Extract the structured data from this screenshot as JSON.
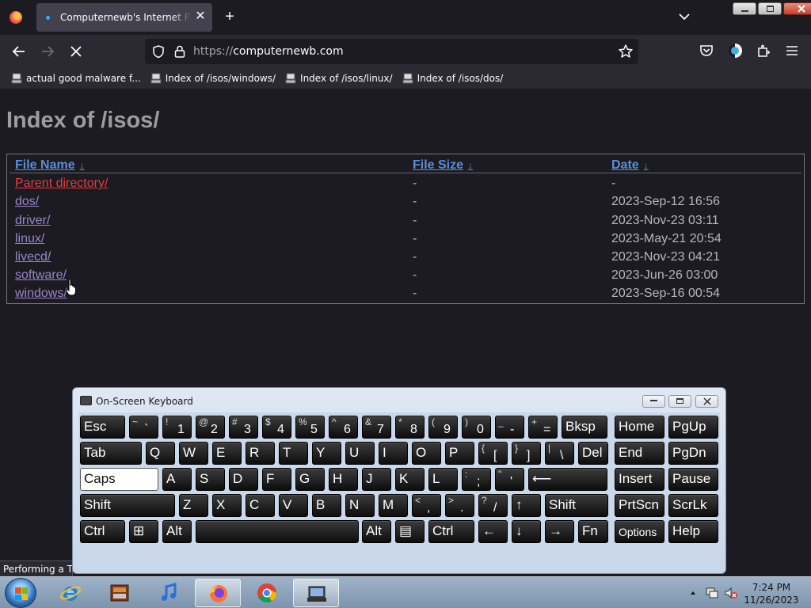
{
  "browser": {
    "tab_title": "Computernewb's Internet Pub",
    "tab_close": "✕",
    "new_tab": "+",
    "url_scheme": "https://",
    "url_host": "computernewb.com",
    "bookmarks": [
      {
        "label": "actual good malware f..."
      },
      {
        "label": "Index of /isos/windows/"
      },
      {
        "label": "Index of /isos/linux/"
      },
      {
        "label": "Index of /isos/dos/"
      }
    ]
  },
  "page": {
    "title": "Index of /isos/",
    "headers": {
      "name": "File Name",
      "size": "File Size",
      "date": "Date",
      "sort_indicator": "↓"
    },
    "rows": [
      {
        "name": "Parent directory/",
        "size": "-",
        "date": "-"
      },
      {
        "name": "dos/",
        "size": "-",
        "date": "2023-Sep-12 16:56"
      },
      {
        "name": "driver/",
        "size": "-",
        "date": "2023-Nov-23 03:11"
      },
      {
        "name": "linux/",
        "size": "-",
        "date": "2023-May-21 20:54"
      },
      {
        "name": "livecd/",
        "size": "-",
        "date": "2023-Nov-23 04:21"
      },
      {
        "name": "software/",
        "size": "-",
        "date": "2023-Jun-26 03:00"
      },
      {
        "name": "windows/",
        "size": "-",
        "date": "2023-Sep-16 00:54"
      }
    ]
  },
  "status_text": "Performing a TL",
  "osk": {
    "title": "On-Screen Keyboard",
    "rows": [
      [
        {
          "t": "lbl",
          "l": "Esc"
        },
        {
          "t": "dual",
          "s": "~",
          "c": "`"
        },
        {
          "t": "dual",
          "s": "!",
          "c": "1"
        },
        {
          "t": "dual",
          "s": "@",
          "c": "2"
        },
        {
          "t": "dual",
          "s": "#",
          "c": "3"
        },
        {
          "t": "dual",
          "s": "$",
          "c": "4"
        },
        {
          "t": "dual",
          "s": "%",
          "c": "5"
        },
        {
          "t": "dual",
          "s": "^",
          "c": "6"
        },
        {
          "t": "dual",
          "s": "&",
          "c": "7"
        },
        {
          "t": "dual",
          "s": "*",
          "c": "8"
        },
        {
          "t": "dual",
          "s": "(",
          "c": "9"
        },
        {
          "t": "dual",
          "s": ")",
          "c": "0"
        },
        {
          "t": "dual",
          "s": "_",
          "c": "-"
        },
        {
          "t": "dual",
          "s": "+",
          "c": "="
        },
        {
          "t": "lbl",
          "l": "Bksp"
        },
        {
          "t": "lbl",
          "l": "Home"
        },
        {
          "t": "lbl",
          "l": "PgUp"
        }
      ],
      [
        {
          "t": "lbl",
          "l": "Tab"
        },
        {
          "t": "lbl",
          "l": "Q"
        },
        {
          "t": "lbl",
          "l": "W"
        },
        {
          "t": "lbl",
          "l": "E"
        },
        {
          "t": "lbl",
          "l": "R"
        },
        {
          "t": "lbl",
          "l": "T"
        },
        {
          "t": "lbl",
          "l": "Y"
        },
        {
          "t": "lbl",
          "l": "U"
        },
        {
          "t": "lbl",
          "l": "I"
        },
        {
          "t": "lbl",
          "l": "O"
        },
        {
          "t": "lbl",
          "l": "P"
        },
        {
          "t": "dual",
          "s": "{",
          "c": "["
        },
        {
          "t": "dual",
          "s": "}",
          "c": "]"
        },
        {
          "t": "dual",
          "s": "|",
          "c": "\\"
        },
        {
          "t": "lbl",
          "l": "Del"
        },
        {
          "t": "lbl",
          "l": "End"
        },
        {
          "t": "lbl",
          "l": "PgDn"
        }
      ],
      [
        {
          "t": "lbl",
          "l": "Caps"
        },
        {
          "t": "lbl",
          "l": "A"
        },
        {
          "t": "lbl",
          "l": "S"
        },
        {
          "t": "lbl",
          "l": "D"
        },
        {
          "t": "lbl",
          "l": "F"
        },
        {
          "t": "lbl",
          "l": "G"
        },
        {
          "t": "lbl",
          "l": "H"
        },
        {
          "t": "lbl",
          "l": "J"
        },
        {
          "t": "lbl",
          "l": "K"
        },
        {
          "t": "lbl",
          "l": "L"
        },
        {
          "t": "dual",
          "s": ":",
          "c": ";"
        },
        {
          "t": "dual",
          "s": "\"",
          "c": "'"
        },
        {
          "t": "lbl",
          "l": "⟵"
        },
        {
          "t": "lbl",
          "l": "Insert"
        },
        {
          "t": "lbl",
          "l": "Pause"
        }
      ],
      [
        {
          "t": "lbl",
          "l": "Shift"
        },
        {
          "t": "lbl",
          "l": "Z"
        },
        {
          "t": "lbl",
          "l": "X"
        },
        {
          "t": "lbl",
          "l": "C"
        },
        {
          "t": "lbl",
          "l": "V"
        },
        {
          "t": "lbl",
          "l": "B"
        },
        {
          "t": "lbl",
          "l": "N"
        },
        {
          "t": "lbl",
          "l": "M"
        },
        {
          "t": "dual",
          "s": "<",
          "c": ","
        },
        {
          "t": "dual",
          "s": ">",
          "c": "."
        },
        {
          "t": "dual",
          "s": "?",
          "c": "/"
        },
        {
          "t": "lbl",
          "l": "↑"
        },
        {
          "t": "lbl",
          "l": "Shift"
        },
        {
          "t": "lbl",
          "l": "PrtScn"
        },
        {
          "t": "lbl",
          "l": "ScrLk"
        }
      ],
      [
        {
          "t": "lbl",
          "l": "Ctrl"
        },
        {
          "t": "lbl",
          "l": "⊞"
        },
        {
          "t": "lbl",
          "l": "Alt"
        },
        {
          "t": "lbl",
          "l": ""
        },
        {
          "t": "lbl",
          "l": "Alt"
        },
        {
          "t": "lbl",
          "l": "▤"
        },
        {
          "t": "lbl",
          "l": "Ctrl"
        },
        {
          "t": "lbl",
          "l": "←"
        },
        {
          "t": "lbl",
          "l": "↓"
        },
        {
          "t": "lbl",
          "l": "→"
        },
        {
          "t": "lbl",
          "l": "Fn"
        },
        {
          "t": "lbl",
          "l": "Options",
          "small": true
        },
        {
          "t": "lbl",
          "l": "Help"
        }
      ]
    ]
  },
  "taskbar": {
    "time": "7:24 PM",
    "date": "11/26/2023"
  }
}
